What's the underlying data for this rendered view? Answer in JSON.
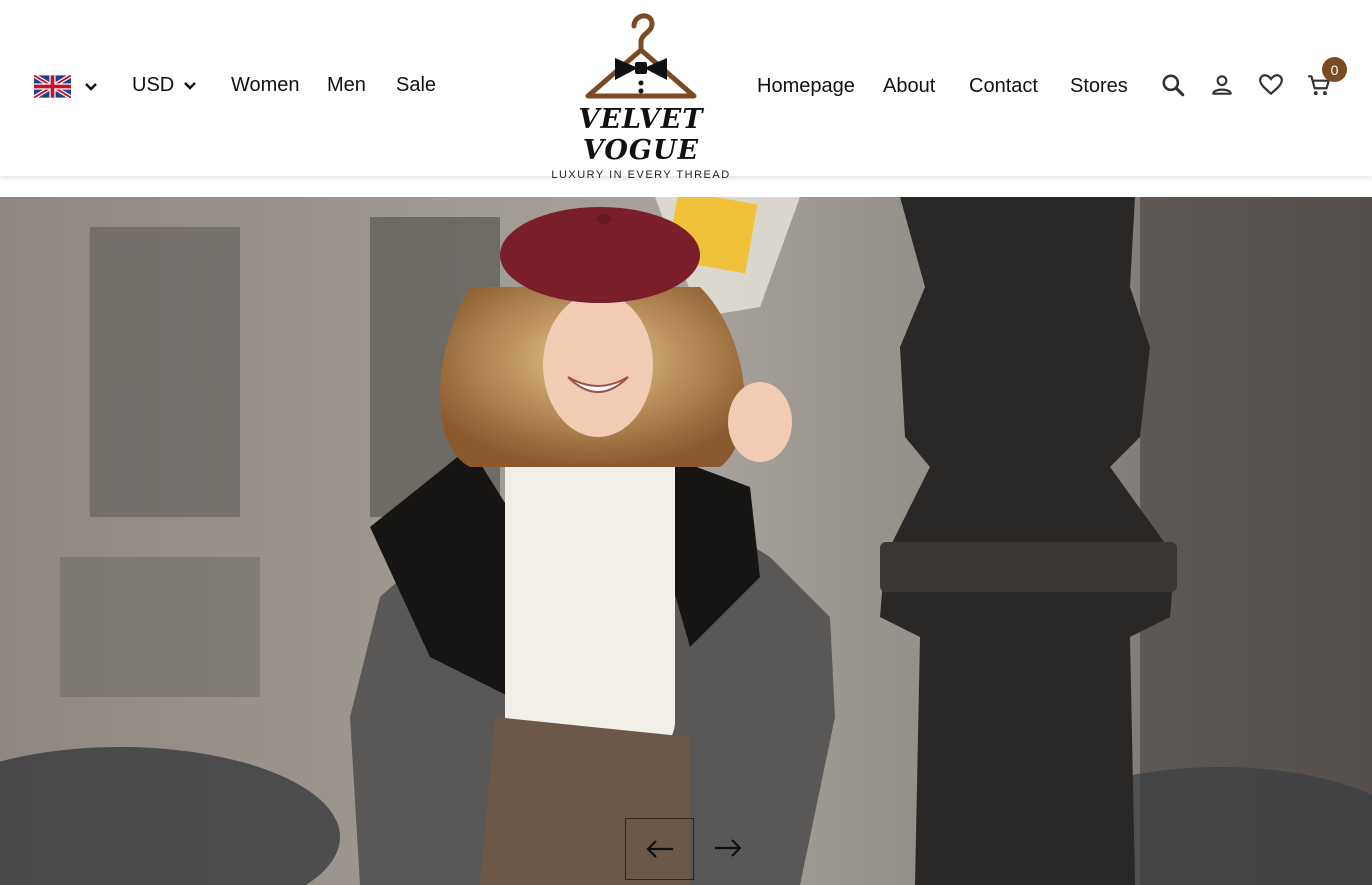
{
  "header": {
    "language": {
      "selected": "English (UK)",
      "flag_icon": "uk-flag-icon"
    },
    "currency": {
      "selected": "USD"
    },
    "left_nav": [
      {
        "label": "Women"
      },
      {
        "label": "Men"
      },
      {
        "label": "Sale"
      }
    ],
    "logo": {
      "brand": "VELVET VOGUE",
      "tagline": "LUXURY IN EVERY THREAD",
      "icon": "hanger-bowtie-icon"
    },
    "right_nav": [
      {
        "label": "Homepage"
      },
      {
        "label": "About"
      },
      {
        "label": "Contact"
      },
      {
        "label": "Stores"
      }
    ],
    "actions": {
      "search_icon": "search-icon",
      "account_icon": "user-icon",
      "wishlist_icon": "heart-icon",
      "cart_icon": "cart-icon",
      "cart_count": "0"
    }
  },
  "hero": {
    "image": "woman-in-beret-street-photo",
    "prev_icon": "arrow-left-icon",
    "next_icon": "arrow-right-icon"
  },
  "colors": {
    "accent": "#7a4a22",
    "text": "#111111",
    "beret": "#7a1e2c",
    "header_bg": "#ffffff"
  }
}
